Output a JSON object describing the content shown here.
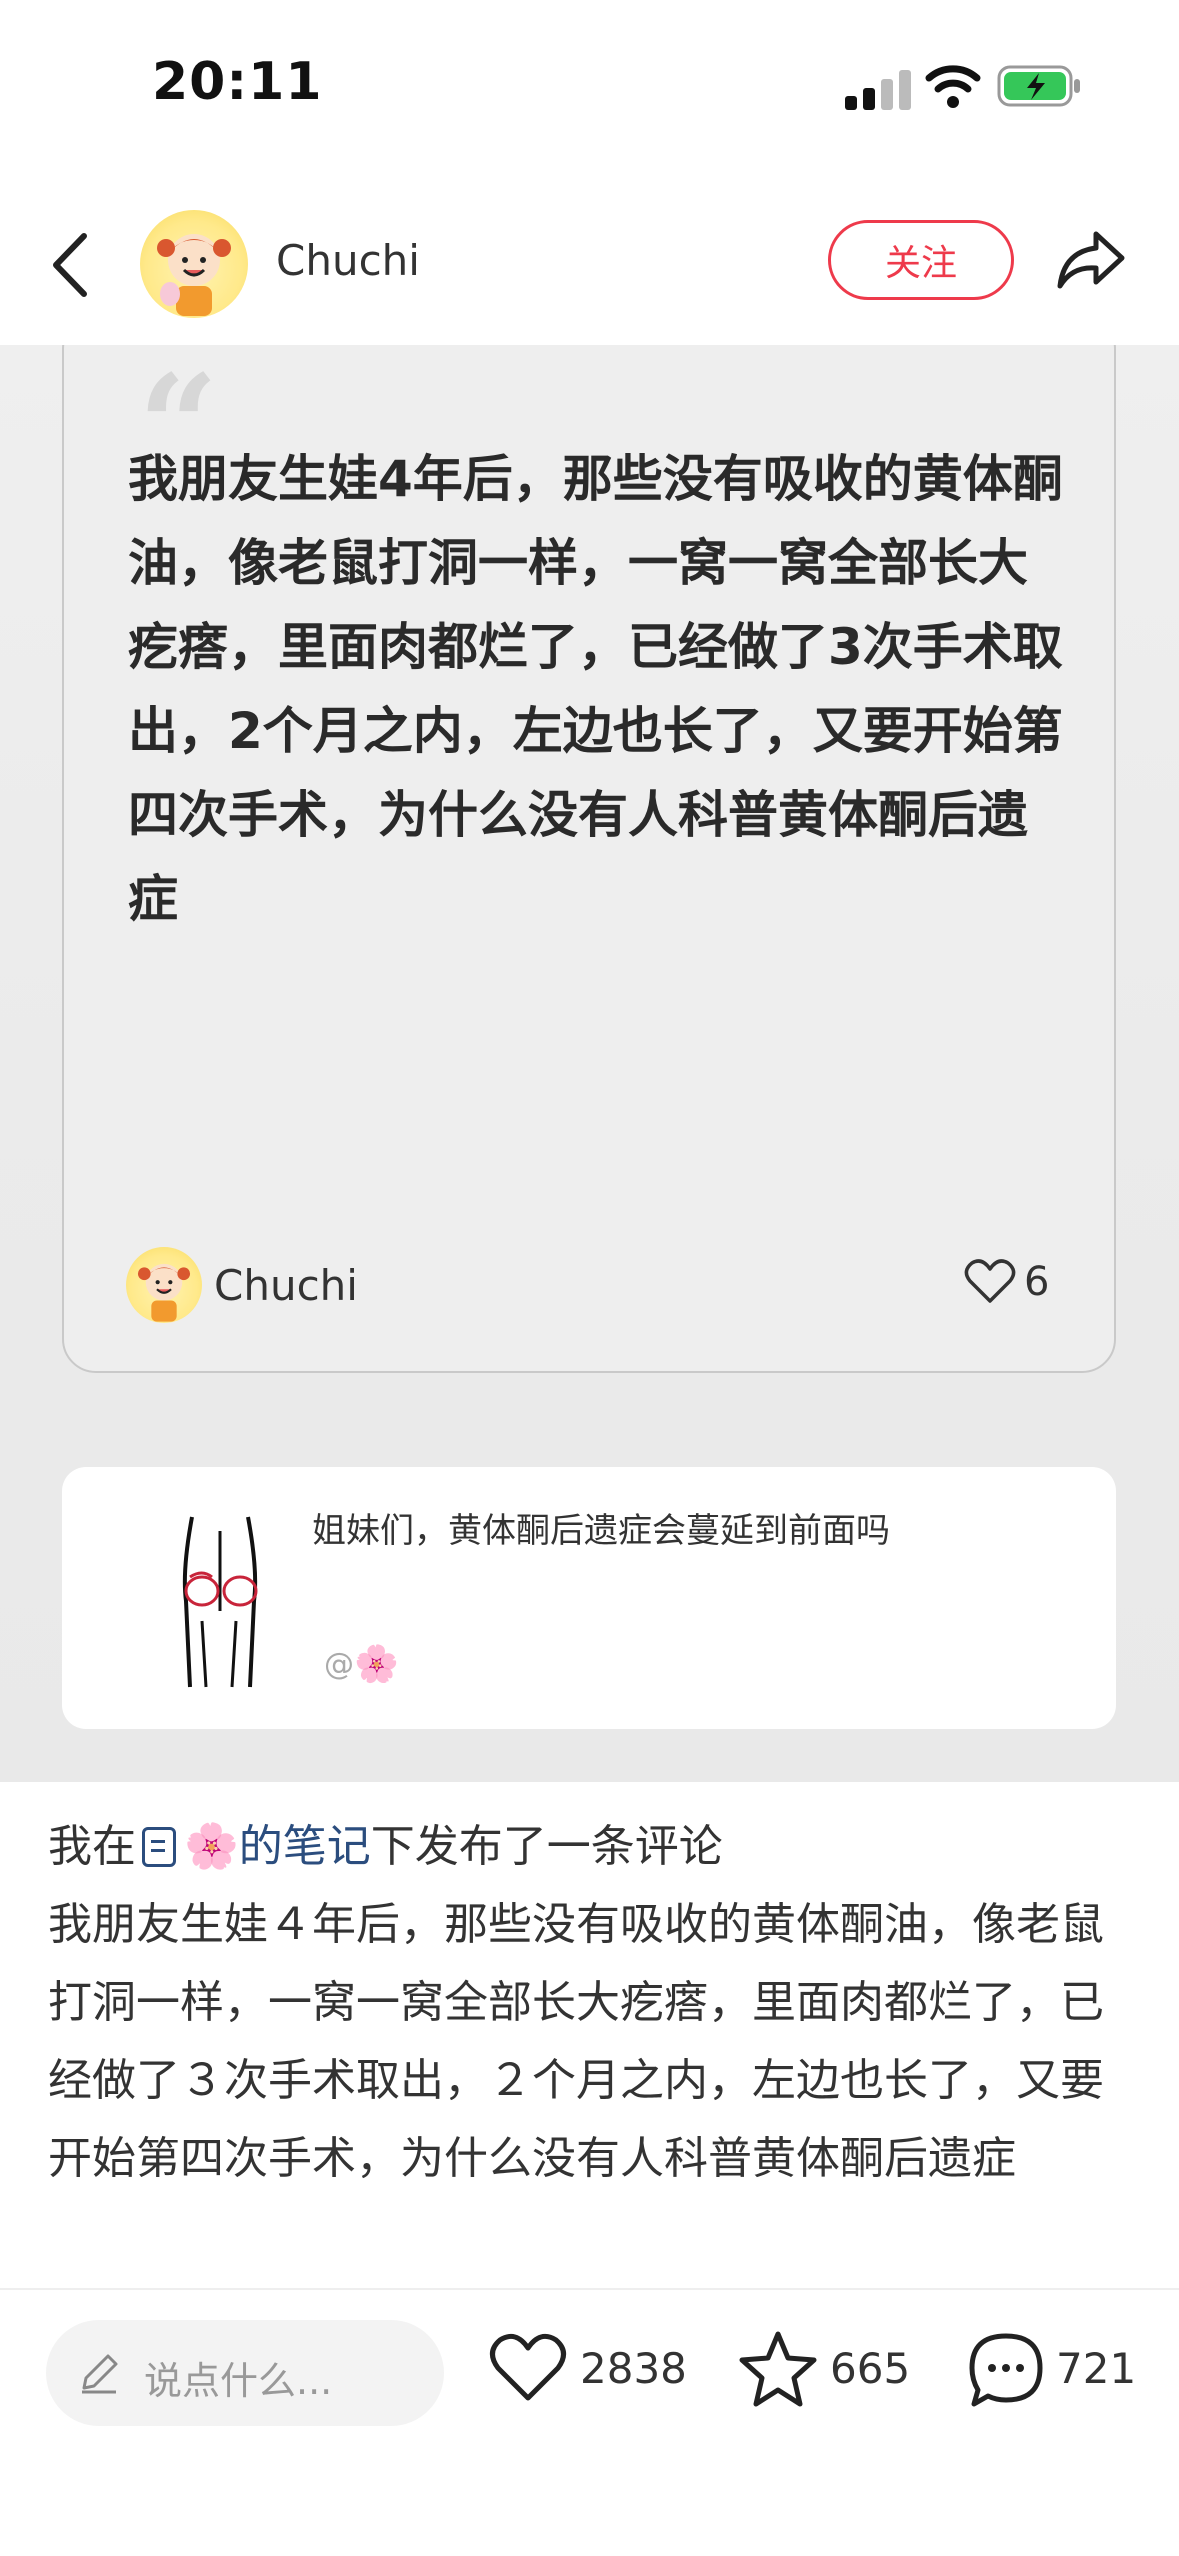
{
  "status_bar": {
    "time": "20:11"
  },
  "header": {
    "username": "Chuchi",
    "follow_label": "关注"
  },
  "image_card": {
    "quote_mark": "“",
    "text": "我朋友生娃4年后，那些没有吸收的黄体酮油，像老鼠打洞一样，一窝一窝全部长大疙瘩，里面肉都烂了，已经做了3次手术取出，2个月之内，左边也长了，又要开始第四次手术，为什么没有人科普黄体酮后遗症",
    "username": "Chuchi",
    "likes": "6"
  },
  "referenced_note": {
    "title": "姐妹们，黄体酮后遗症会蔓延到前面吗",
    "at_symbol": "@",
    "flower": "🌸"
  },
  "caption": {
    "prefix": "我在",
    "flower": "🌸",
    "link_text": "的笔记",
    "suffix": "下发布了一条评论",
    "body": "我朋友生娃４年后，那些没有吸收的黄体酮油，像老鼠打洞一样，一窝一窝全部长大疙瘩，里面肉都烂了，已经做了３次手术取出，２个月之内，左边也长了，又要开始第四次手术，为什么没有人科普黄体酮后遗症"
  },
  "bottom_bar": {
    "comment_placeholder": "说点什么...",
    "like_count": "2838",
    "favorite_count": "665",
    "comment_count": "721"
  },
  "colors": {
    "accent": "#ee3a4b",
    "link": "#2b4d7e"
  }
}
